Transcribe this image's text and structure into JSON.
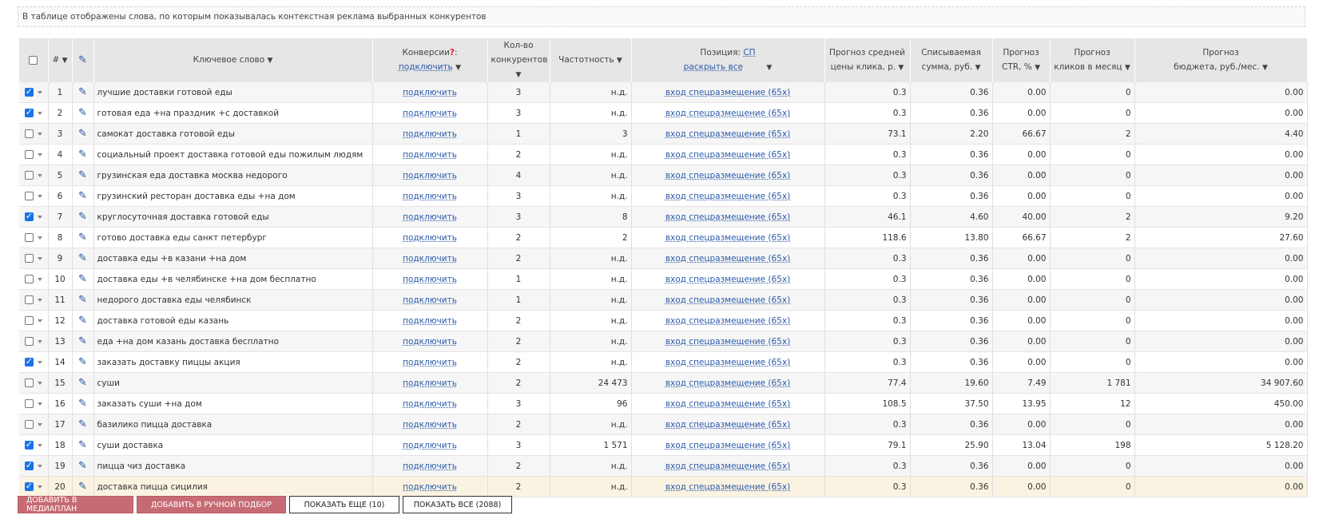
{
  "notice": "В таблице отображены слова, по которым показывалась контекстная реклама выбранных конкурентов",
  "headers": {
    "num": "#",
    "keyword": "Ключевое слово",
    "conversions": "Конверсии",
    "conversions_q": "?",
    "conversions_link": "подключить",
    "competitors_1": "Кол-во",
    "competitors_2": "конкурентов",
    "frequency": "Частотность",
    "position": "Позиция:",
    "position_sp": "СП",
    "position_expand": "раскрыть все",
    "cpc_1": "Прогноз средней",
    "cpc_2": "цены клика, р.",
    "charge_1": "Списываемая",
    "charge_2": "сумма, руб.",
    "ctr_1": "Прогноз",
    "ctr_2": "CTR, %",
    "clicks_1": "Прогноз",
    "clicks_2": "кликов в месяц",
    "budget_1": "Прогноз",
    "budget_2": "бюджета, руб./мес."
  },
  "rows": [
    {
      "n": "1",
      "checked": true,
      "kw": "лучшие доставки готовой еды",
      "conv": "подключить",
      "comp": "3",
      "freq": "н.д.",
      "pos": "вход спецразмещение (65x)",
      "cpc": "0.3",
      "charge": "0.36",
      "ctr": "0.00",
      "clicks": "0",
      "budget": "0.00"
    },
    {
      "n": "2",
      "checked": true,
      "kw": "готовая еда +на праздник +с доставкой",
      "conv": "подключить",
      "comp": "3",
      "freq": "н.д.",
      "pos": "вход спецразмещение (65x)",
      "cpc": "0.3",
      "charge": "0.36",
      "ctr": "0.00",
      "clicks": "0",
      "budget": "0.00"
    },
    {
      "n": "3",
      "checked": false,
      "kw": "самокат доставка готовой еды",
      "conv": "подключить",
      "comp": "1",
      "freq": "3",
      "pos": "вход спецразмещение (65x)",
      "cpc": "73.1",
      "charge": "2.20",
      "ctr": "66.67",
      "clicks": "2",
      "budget": "4.40"
    },
    {
      "n": "4",
      "checked": false,
      "kw": "социальный проект доставка готовой еды пожилым людям",
      "conv": "подключить",
      "comp": "2",
      "freq": "н.д.",
      "pos": "вход спецразмещение (65x)",
      "cpc": "0.3",
      "charge": "0.36",
      "ctr": "0.00",
      "clicks": "0",
      "budget": "0.00"
    },
    {
      "n": "5",
      "checked": false,
      "kw": "грузинская еда доставка москва недорого",
      "conv": "подключить",
      "comp": "4",
      "freq": "н.д.",
      "pos": "вход спецразмещение (65x)",
      "cpc": "0.3",
      "charge": "0.36",
      "ctr": "0.00",
      "clicks": "0",
      "budget": "0.00"
    },
    {
      "n": "6",
      "checked": false,
      "kw": "грузинский ресторан доставка еды +на дом",
      "conv": "подключить",
      "comp": "3",
      "freq": "н.д.",
      "pos": "вход спецразмещение (65x)",
      "cpc": "0.3",
      "charge": "0.36",
      "ctr": "0.00",
      "clicks": "0",
      "budget": "0.00"
    },
    {
      "n": "7",
      "checked": true,
      "kw": "круглосуточная доставка готовой еды",
      "conv": "подключить",
      "comp": "3",
      "freq": "8",
      "pos": "вход спецразмещение (65x)",
      "cpc": "46.1",
      "charge": "4.60",
      "ctr": "40.00",
      "clicks": "2",
      "budget": "9.20"
    },
    {
      "n": "8",
      "checked": false,
      "kw": "готово доставка еды санкт петербург",
      "conv": "подключить",
      "comp": "2",
      "freq": "2",
      "pos": "вход спецразмещение (65x)",
      "cpc": "118.6",
      "charge": "13.80",
      "ctr": "66.67",
      "clicks": "2",
      "budget": "27.60"
    },
    {
      "n": "9",
      "checked": false,
      "kw": "доставка еды +в казани +на дом",
      "conv": "подключить",
      "comp": "2",
      "freq": "н.д.",
      "pos": "вход спецразмещение (65x)",
      "cpc": "0.3",
      "charge": "0.36",
      "ctr": "0.00",
      "clicks": "0",
      "budget": "0.00"
    },
    {
      "n": "10",
      "checked": false,
      "kw": "доставка еды +в челябинске +на дом бесплатно",
      "conv": "подключить",
      "comp": "1",
      "freq": "н.д.",
      "pos": "вход спецразмещение (65x)",
      "cpc": "0.3",
      "charge": "0.36",
      "ctr": "0.00",
      "clicks": "0",
      "budget": "0.00"
    },
    {
      "n": "11",
      "checked": false,
      "kw": "недорого доставка еды челябинск",
      "conv": "подключить",
      "comp": "1",
      "freq": "н.д.",
      "pos": "вход спецразмещение (65x)",
      "cpc": "0.3",
      "charge": "0.36",
      "ctr": "0.00",
      "clicks": "0",
      "budget": "0.00"
    },
    {
      "n": "12",
      "checked": false,
      "kw": "доставка готовой еды казань",
      "conv": "подключить",
      "comp": "2",
      "freq": "н.д.",
      "pos": "вход спецразмещение (65x)",
      "cpc": "0.3",
      "charge": "0.36",
      "ctr": "0.00",
      "clicks": "0",
      "budget": "0.00"
    },
    {
      "n": "13",
      "checked": false,
      "kw": "еда +на дом казань доставка бесплатно",
      "conv": "подключить",
      "comp": "2",
      "freq": "н.д.",
      "pos": "вход спецразмещение (65x)",
      "cpc": "0.3",
      "charge": "0.36",
      "ctr": "0.00",
      "clicks": "0",
      "budget": "0.00"
    },
    {
      "n": "14",
      "checked": true,
      "kw": "заказать доставку пиццы акция",
      "conv": "подключить",
      "comp": "2",
      "freq": "н.д.",
      "pos": "вход спецразмещение (65x)",
      "cpc": "0.3",
      "charge": "0.36",
      "ctr": "0.00",
      "clicks": "0",
      "budget": "0.00"
    },
    {
      "n": "15",
      "checked": false,
      "kw": "суши",
      "conv": "подключить",
      "comp": "2",
      "freq": "24 473",
      "pos": "вход спецразмещение (65x)",
      "cpc": "77.4",
      "charge": "19.60",
      "ctr": "7.49",
      "clicks": "1 781",
      "budget": "34 907.60"
    },
    {
      "n": "16",
      "checked": false,
      "kw": "заказать суши +на дом",
      "conv": "подключить",
      "comp": "3",
      "freq": "96",
      "pos": "вход спецразмещение (65x)",
      "cpc": "108.5",
      "charge": "37.50",
      "ctr": "13.95",
      "clicks": "12",
      "budget": "450.00"
    },
    {
      "n": "17",
      "checked": false,
      "kw": "базилико пицца доставка",
      "conv": "подключить",
      "comp": "2",
      "freq": "н.д.",
      "pos": "вход спецразмещение (65x)",
      "cpc": "0.3",
      "charge": "0.36",
      "ctr": "0.00",
      "clicks": "0",
      "budget": "0.00"
    },
    {
      "n": "18",
      "checked": true,
      "kw": "суши доставка",
      "conv": "подключить",
      "comp": "3",
      "freq": "1 571",
      "pos": "вход спецразмещение (65x)",
      "cpc": "79.1",
      "charge": "25.90",
      "ctr": "13.04",
      "clicks": "198",
      "budget": "5 128.20"
    },
    {
      "n": "19",
      "checked": true,
      "kw": "пицца чиз доставка",
      "conv": "подключить",
      "comp": "2",
      "freq": "н.д.",
      "pos": "вход спецразмещение (65x)",
      "cpc": "0.3",
      "charge": "0.36",
      "ctr": "0.00",
      "clicks": "0",
      "budget": "0.00"
    },
    {
      "n": "20",
      "checked": true,
      "kw": "доставка пицца сицилия",
      "conv": "подключить",
      "comp": "2",
      "freq": "н.д.",
      "pos": "вход спецразмещение (65x)",
      "cpc": "0.3",
      "charge": "0.36",
      "ctr": "0.00",
      "clicks": "0",
      "budget": "0.00"
    }
  ],
  "buttons": {
    "add_mediaplan": "ДОБАВИТЬ В МЕДИАПЛАН",
    "add_manual": "ДОБАВИТЬ В РУЧНОЙ ПОДБОР",
    "show_more": "ПОКАЗАТЬ ЕЩЕ (10)",
    "show_all": "ПОКАЗАТЬ ВСЕ (2088)"
  }
}
